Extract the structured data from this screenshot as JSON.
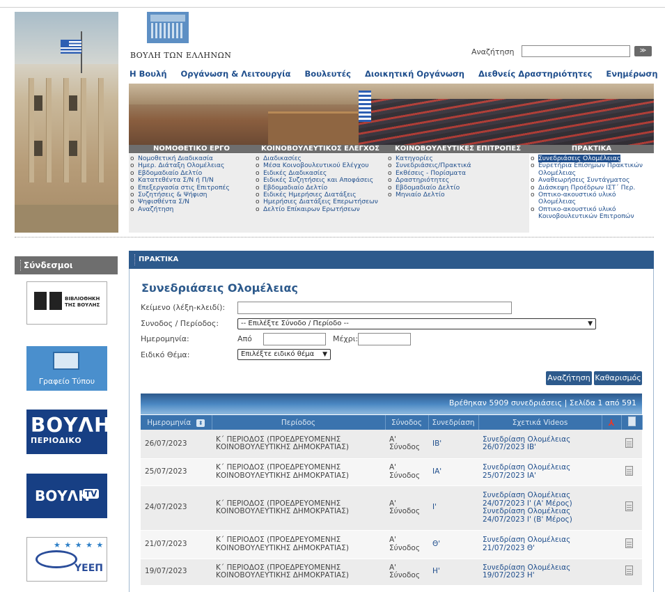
{
  "header": {
    "logo_text": "ΒΟΥΛΗ ΤΩΝ ΕΛΛΗΝΩΝ",
    "search_label": "Αναζήτηση",
    "search_value": "",
    "search_go": "≫"
  },
  "mainnav": [
    "Η Βουλή",
    "Οργάνωση & Λειτουργία",
    "Βουλευτές",
    "Διοικητική Οργάνωση",
    "Διεθνείς Δραστηριότητες",
    "Ενημέρωση"
  ],
  "sections": [
    {
      "title": "ΝΟΜΟΘΕΤΙΚΟ ΕΡΓΟ",
      "items": [
        "Νομοθετική Διαδικασία",
        "Ημερ. Διάταξη Ολομέλειας",
        "Εβδομαδιαίο Δελτίο",
        "Κατατεθέντα Σ/Ν ή Π/Ν",
        "Επεξεργασία στις Επιτροπές",
        "Συζητήσεις & Ψήφιση",
        "Ψηφισθέντα Σ/Ν",
        "Αναζήτηση"
      ]
    },
    {
      "title": "ΚΟΙΝΟΒΟΥΛΕΥΤΙΚΟΣ ΕΛΕΓΧΟΣ",
      "items": [
        "Διαδικασίες",
        "Μέσα Κοινοβουλευτικού Ελέγχου",
        "Ειδικές Διαδικασίες",
        "Ειδικές Συζητήσεις και Αποφάσεις",
        "Εβδομαδιαίο Δελτίο",
        "Ειδικές Ημερήσιες Διατάξεις",
        "Ημερήσιες Διατάξεις Επερωτήσεων",
        "Δελτίο Επίκαιρων Ερωτήσεων"
      ]
    },
    {
      "title": "ΚΟΙΝΟΒΟΥΛΕΥΤΙΚΕΣ ΕΠΙΤΡΟΠΕΣ",
      "items": [
        "Κατηγορίες",
        "Συνεδριάσεις/Πρακτικά",
        "Εκθέσεις - Πορίσματα",
        "Δραστηριότητες",
        "Εβδομαδιαίο Δελτίο",
        "Μηνιαίο Δελτίο"
      ]
    },
    {
      "title": "ΠΡΑΚΤΙΚΑ",
      "items": [
        "Συνεδριάσεις Ολομέλειας",
        "Ευρετήρια Επίσημων Πρακτικών Ολομέλειας",
        "Αναθεωρήσεις Συντάγματος",
        "Διάσκεψη Προέδρων ΙΣΤ΄ Περ.",
        "Οπτικο-ακουστικό υλικό Ολομέλειας",
        "Οπτικο-ακουστικό υλικό Κοινοβουλευτικών Επιτροπών"
      ]
    }
  ],
  "sidebar": {
    "title": "Σύνδεσμοι",
    "library_text_1": "ΒΙΒΛΙΟΘΗΚΗ",
    "library_text_2": "ΤΗΣ ΒΟΥΛΗΣ",
    "press_office": "Γραφείο Τύπου",
    "magazine_big": "ΒΟΥΛΗ",
    "magazine_small": "ΠΕΡΙΟΔΙΚΟ",
    "tv_text": "ΒΟΥΛΗ",
    "tv_badge": "TV",
    "yeep_text": "ΥΕΕΠ",
    "yeep_stars": "★ ★ ★ ★ ★"
  },
  "panel": {
    "header": "ΠΡΑΚΤΙΚΑ",
    "title": "Συνεδριάσεις Ολομέλειας",
    "keyword_label": "Κείμενο (λέξη-κλειδί):",
    "keyword_value": "",
    "session_label": "Συνοδος / Περίοδος:",
    "session_value": "-- Επιλέξτε Σύνοδο / Περίοδο --",
    "date_label": "Ημερομηνία:",
    "from_label": "Από",
    "to_label": "Μέχρι:",
    "topic_label": "Ειδικό Θέμα:",
    "topic_value": "Επιλέξτε ειδικό θέμα",
    "search_btn": "Αναζήτηση",
    "clear_btn": "Καθαρισμός",
    "results_text": "Βρέθηκαν 5909 συνεδριάσεις | Σελίδα 1 από 591"
  },
  "table": {
    "headers": [
      "Ημερομηνία",
      "Περίοδος",
      "Σύνοδος",
      "Συνεδρίαση",
      "Σχετικά Videos"
    ],
    "rows": [
      {
        "date": "26/07/2023",
        "period": "Κ΄ ΠΕΡΙΟΔΟΣ (ΠΡΟΕΔΡΕΥΟΜΕΝΗΣ ΚΟΙΝΟΒΟΥΛΕΥΤΙΚΗΣ ΔΗΜΟΚΡΑΤΙΑΣ)",
        "session": "Α' Σύνοδος",
        "sitting": "ΙΒ'",
        "videos": "Συνεδρίαση Ολομέλειας 26/07/2023 ΙΒ'"
      },
      {
        "date": "25/07/2023",
        "period": "Κ΄ ΠΕΡΙΟΔΟΣ (ΠΡΟΕΔΡΕΥΟΜΕΝΗΣ ΚΟΙΝΟΒΟΥΛΕΥΤΙΚΗΣ ΔΗΜΟΚΡΑΤΙΑΣ)",
        "session": "Α' Σύνοδος",
        "sitting": "ΙΑ'",
        "videos": "Συνεδρίαση Ολομέλειας 25/07/2023 ΙΑ'"
      },
      {
        "date": "24/07/2023",
        "period": "Κ΄ ΠΕΡΙΟΔΟΣ (ΠΡΟΕΔΡΕΥΟΜΕΝΗΣ ΚΟΙΝΟΒΟΥΛΕΥΤΙΚΗΣ ΔΗΜΟΚΡΑΤΙΑΣ)",
        "session": "Α' Σύνοδος",
        "sitting": "Ι'",
        "videos": "Συνεδρίαση Ολομέλειας 24/07/2023 Ι' (Α' Μέρος) Συνεδρίαση Ολομέλειας 24/07/2023 Ι' (Β' Μέρος)"
      },
      {
        "date": "21/07/2023",
        "period": "Κ΄ ΠΕΡΙΟΔΟΣ (ΠΡΟΕΔΡΕΥΟΜΕΝΗΣ ΚΟΙΝΟΒΟΥΛΕΥΤΙΚΗΣ ΔΗΜΟΚΡΑΤΙΑΣ)",
        "session": "Α' Σύνοδος",
        "sitting": "Θ'",
        "videos": "Συνεδρίαση Ολομέλειας 21/07/2023 Θ'"
      },
      {
        "date": "19/07/2023",
        "period": "Κ΄ ΠΕΡΙΟΔΟΣ (ΠΡΟΕΔΡΕΥΟΜΕΝΗΣ ΚΟΙΝΟΒΟΥΛΕΥΤΙΚΗΣ ΔΗΜΟΚΡΑΤΙΑΣ)",
        "session": "Α' Σύνοδος",
        "sitting": "Η'",
        "videos": "Συνεδρίαση Ολομέλειας 19/07/2023 Η'"
      }
    ]
  }
}
